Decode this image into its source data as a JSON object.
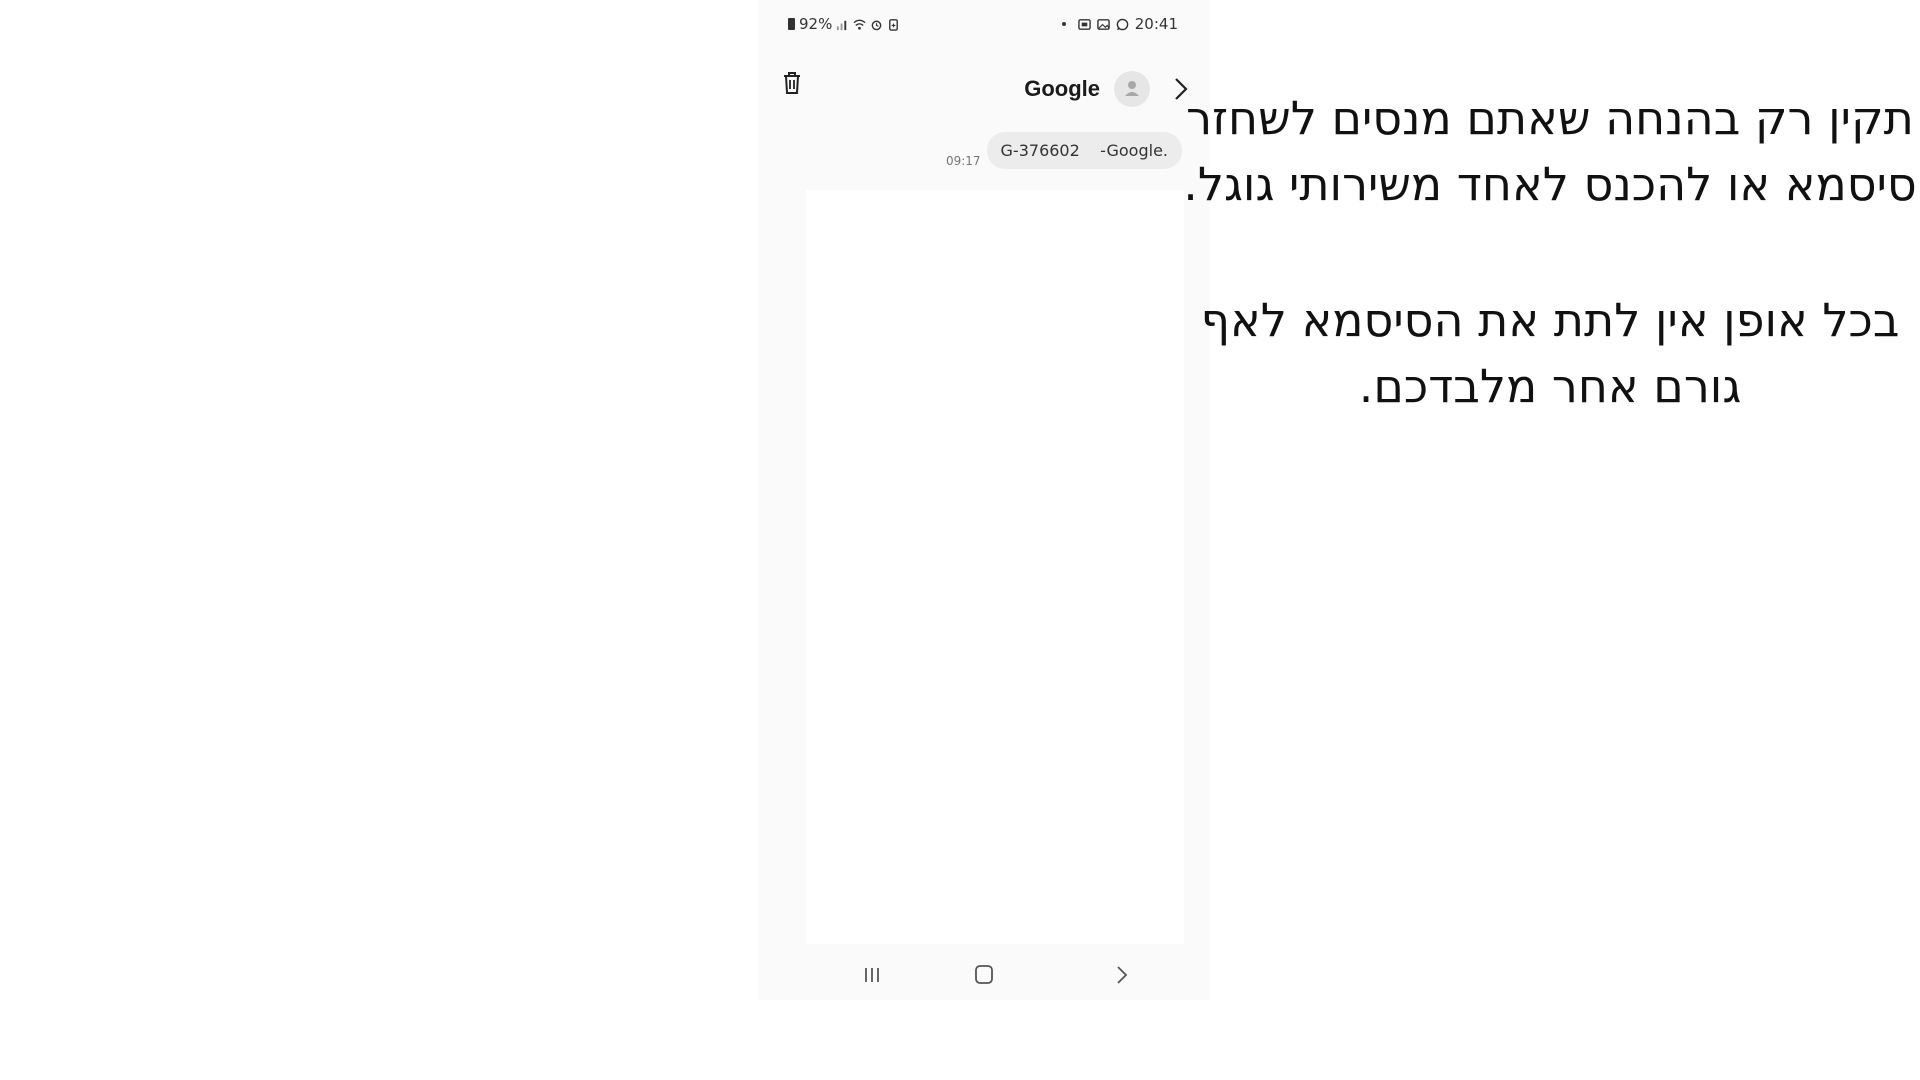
{
  "status_bar": {
    "battery": "92%",
    "time": "20:41"
  },
  "conversation": {
    "contact_name": "Google",
    "message": {
      "time": "09:17",
      "text": "G-376602    -Google."
    }
  },
  "caption": {
    "paragraph_1": "תקין רק בהנחה שאתם מנסים לשחזר סיסמא או להכנס לאחד משירותי גוגל.",
    "paragraph_2": "בכל אופן אין לתת את הסיסמא לאף גורם אחר מלבדכם."
  },
  "icons": {
    "trash": "trash-icon",
    "avatar": "person-icon",
    "forward": "chevron-right-icon",
    "nav_recent": "recent-apps-icon",
    "nav_home": "home-icon",
    "nav_back": "back-icon"
  }
}
